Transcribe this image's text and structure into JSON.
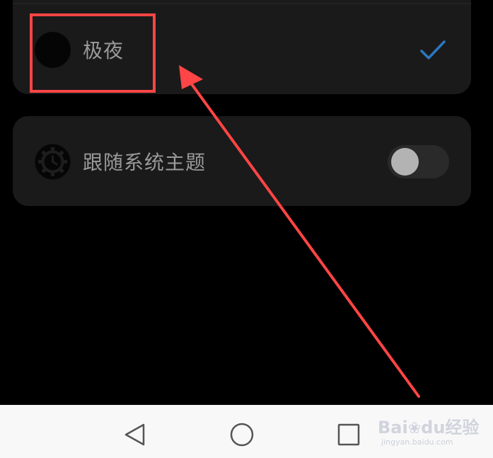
{
  "settings": {
    "theme_option": {
      "label": "极夜",
      "selected": true,
      "icon": "check-icon",
      "check_color": "#2a77c2"
    },
    "follow_system": {
      "label": "跟随系统主题",
      "icon": "gear-icon",
      "toggle_on": false
    }
  },
  "annotation": {
    "box_color": "#ff4545",
    "arrow_color": "#ff4545"
  },
  "navbar": {
    "back_icon": "back-triangle-icon",
    "home_icon": "home-circle-icon",
    "recent_icon": "recent-square-icon"
  },
  "watermark": {
    "logo": "Bai",
    "logo_tail": "du",
    "logo_cn": "经验",
    "url": "jingyan.baidu.com"
  }
}
